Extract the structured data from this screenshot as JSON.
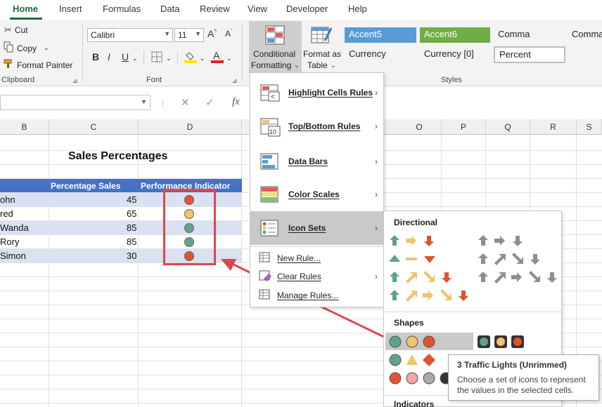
{
  "ribbon_tabs": [
    "Home",
    "Insert",
    "Formulas",
    "Data",
    "Review",
    "View",
    "Developer",
    "Help"
  ],
  "clipboard": {
    "cut": "Cut",
    "copy": "Copy",
    "format_painter": "Format Painter",
    "group_label": "Clipboard"
  },
  "font": {
    "name": "Calibri",
    "size": "11",
    "group_label": "Font"
  },
  "cf_button": {
    "line1": "Conditional",
    "line2": "Formatting"
  },
  "fat_button": {
    "line1": "Format as",
    "line2": "Table"
  },
  "styles": {
    "accent5": "Accent5",
    "accent6": "Accent6",
    "comma": "Comma",
    "comma0": "Comma",
    "currency": "Currency",
    "currency0": "Currency [0]",
    "percent": "Percent",
    "group_label": "Styles",
    "accent5_color": "#5b9bd5",
    "accent6_color": "#70ad47"
  },
  "formula_bar": {
    "fx": "fx"
  },
  "columns_left": [
    "B",
    "C",
    "D"
  ],
  "columns_right": [
    "O",
    "P",
    "Q",
    "R",
    "S"
  ],
  "sheet": {
    "title": "Sales Percentages",
    "header_c": "Percentage Sales",
    "header_d": "Performance Indicator",
    "header_color": "#4472c4",
    "rows": [
      {
        "name": "ohn",
        "value": "45",
        "indicator_color": "#e0532f"
      },
      {
        "name": "red",
        "value": "65",
        "indicator_color": "#f2c26e"
      },
      {
        "name": "Wanda",
        "value": "85",
        "indicator_color": "#5ea38a"
      },
      {
        "name": "Rory",
        "value": "85",
        "indicator_color": "#5ea38a"
      },
      {
        "name": "Simon",
        "value": "30",
        "indicator_color": "#e0532f"
      }
    ]
  },
  "menu": {
    "highlight": "Highlight Cells Rules",
    "topbottom": "Top/Bottom Rules",
    "databars": "Data Bars",
    "colorscales": "Color Scales",
    "iconsets": "Icon Sets",
    "newrule": "New Rule...",
    "clearrules": "Clear Rules",
    "managerules": "Manage Rules..."
  },
  "icon_sets": {
    "directional": "Directional",
    "shapes": "Shapes",
    "indicators": "Indicators"
  },
  "tooltip": {
    "title": "3 Traffic Lights (Unrimmed)",
    "body": "Choose a set of icons to represent the values in the selected cells."
  },
  "colors": {
    "green": "#5ea38a",
    "yellow": "#f2c26e",
    "red": "#e0532f",
    "gray": "#8e8e8e",
    "annotation_red": "#e0454a"
  }
}
